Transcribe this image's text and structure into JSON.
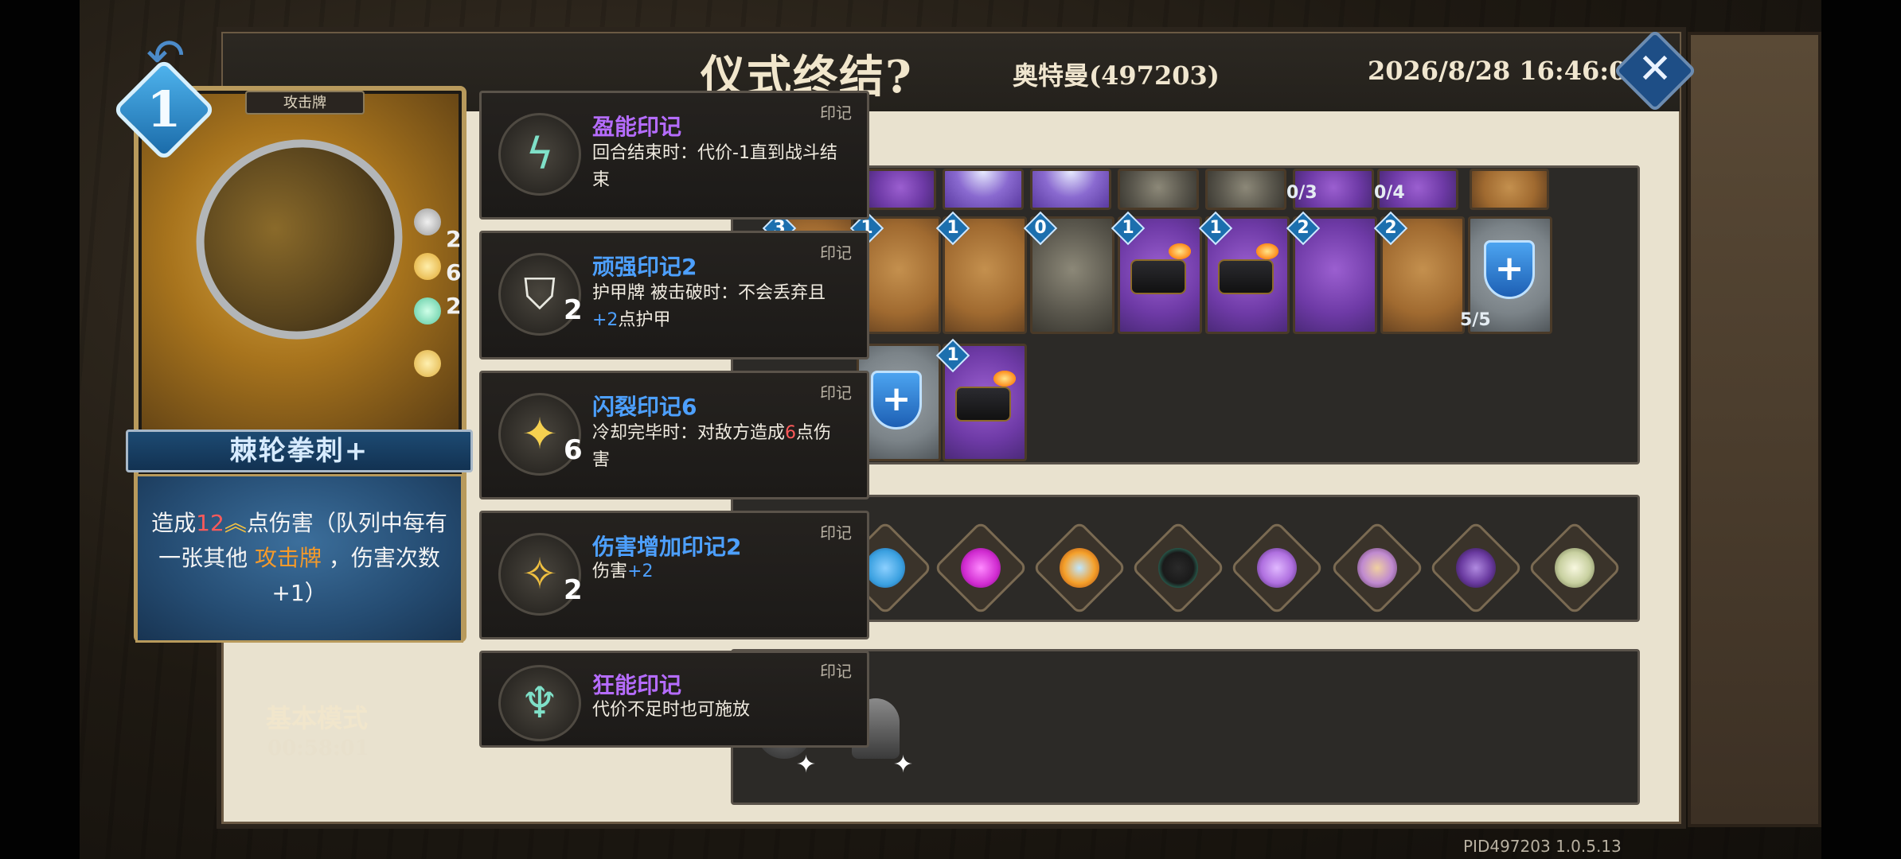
{
  "header": {
    "title": "仪式终结?",
    "player": "奥特曼(497203)",
    "datetime": "2026/8/28 16:46:09",
    "close_icon": "close-icon"
  },
  "card": {
    "type": "攻击牌",
    "cost": "1",
    "name": "棘轮拳刺+",
    "runes": [
      "2",
      "6",
      "2"
    ],
    "desc_prefix": "造成",
    "desc_damage": "12",
    "desc_mid": "点伤害（队列中每有一张其他",
    "desc_keyword": "攻击牌",
    "desc_suffix": "，伤害次数+1）"
  },
  "mode": {
    "label": "基本模式",
    "timer": "00:58:01"
  },
  "tooltips": [
    {
      "title": "盈能印记",
      "tag": "印记",
      "stack": "",
      "color": "#b56cff",
      "body": "回合结束时：代价-1直到战斗结束",
      "icon": "lightning-rune-icon"
    },
    {
      "title": "顽强印记2",
      "tag": "印记",
      "stack": "2",
      "color": "#4da0ff",
      "body_a": "护甲牌 被击破时：不会丢弃且",
      "body_b": "+2",
      "body_c": "点护甲",
      "icon": "shield-rune-icon"
    },
    {
      "title": "闪裂印记6",
      "tag": "印记",
      "stack": "6",
      "color": "#4da0ff",
      "body_a": "冷却完毕时：对敌方造成",
      "body_b": "6",
      "body_c": "点伤害",
      "icon": "spark-rune-icon"
    },
    {
      "title": "伤害增加印记2",
      "tag": "印记",
      "stack": "2",
      "color": "#4da0ff",
      "body_a": "伤害",
      "body_b": "+2",
      "icon": "damage-rune-icon"
    },
    {
      "title": "狂能印记",
      "tag": "印记",
      "stack": "",
      "color": "#b56cff",
      "body": "代价不足时也可施放",
      "icon": "frenzy-rune-icon"
    }
  ],
  "deck": {
    "row1_counts": [
      "0/3",
      "0/4"
    ],
    "row2": [
      {
        "cost": "3",
        "style": "orange"
      },
      {
        "cost": "1",
        "style": "orange"
      },
      {
        "cost": "1",
        "style": "orange"
      },
      {
        "cost": "0",
        "style": "dark"
      },
      {
        "cost": "1",
        "style": "purple"
      },
      {
        "cost": "1",
        "style": "purple"
      },
      {
        "cost": "2",
        "style": "purple"
      },
      {
        "cost": "2",
        "style": "orange"
      },
      {
        "cost": "",
        "style": "grey",
        "count": "5/5"
      }
    ],
    "row3": [
      {
        "cost": "",
        "style": "grey"
      },
      {
        "cost": "1",
        "style": "purple"
      }
    ]
  },
  "relics": [
    {
      "name": "blue-crystal-relic-icon",
      "color": "#3aa0e0"
    },
    {
      "name": "magenta-flame-relic-icon",
      "color": "#d02ad0"
    },
    {
      "name": "fire-shield-relic-icon",
      "color": "#f5a02a"
    },
    {
      "name": "shadow-figure-relic-icon",
      "color": "#3cc8a0"
    },
    {
      "name": "purple-wings-relic-icon",
      "color": "#b070e0"
    },
    {
      "name": "rune-symbol-relic-icon",
      "color": "#c08ad0"
    },
    {
      "name": "dark-crystal-relic-icon",
      "color": "#6a3aa0"
    },
    {
      "name": "scroll-relic-icon",
      "color": "#c8d0a0"
    }
  ],
  "footer": {
    "pid": "PID497203  1.0.5.13"
  }
}
